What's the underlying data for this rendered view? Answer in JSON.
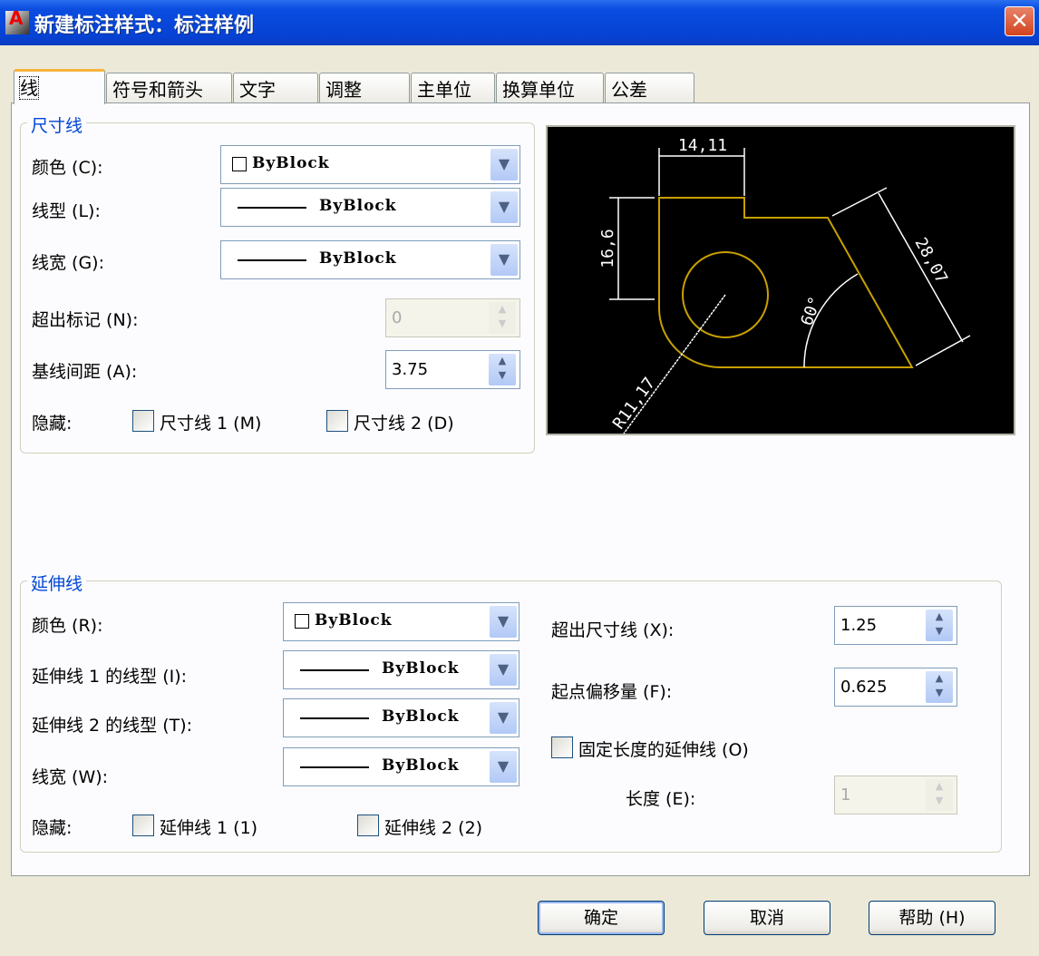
{
  "window": {
    "title": "新建标注样式：标注样例",
    "close": "✕",
    "app_icon": "A"
  },
  "tabs": [
    "线",
    "符号和箭头",
    "文字",
    "调整",
    "主单位",
    "换算单位",
    "公差"
  ],
  "dim_lines": {
    "legend": "尺寸线",
    "color_label": "颜色 (C):",
    "color_value": "ByBlock",
    "linetype_label": "线型 (L):",
    "linetype_value": "ByBlock",
    "lineweight_label": "线宽 (G):",
    "lineweight_value": "ByBlock",
    "extend_ticks_label": "超出标记 (N):",
    "extend_ticks_value": "0",
    "baseline_label": "基线间距 (A):",
    "baseline_value": "3.75",
    "suppress_label": "隐藏:",
    "suppress1": "尺寸线 1 (M)",
    "suppress2": "尺寸线 2 (D)"
  },
  "preview": {
    "dim_top": "14,11",
    "dim_left": "16,6",
    "dim_slant": "28,07",
    "dim_angle": "60°",
    "dim_radius": "R11,17"
  },
  "ext_lines": {
    "legend": "延伸线",
    "color_label": "颜色 (R):",
    "color_value": "ByBlock",
    "lt1_label": "延伸线 1 的线型 (I):",
    "lt1_value": "ByBlock",
    "lt2_label": "延伸线 2 的线型 (T):",
    "lt2_value": "ByBlock",
    "lineweight_label": "线宽 (W):",
    "lineweight_value": "ByBlock",
    "suppress_label": "隐藏:",
    "suppress1": "延伸线 1 (1)",
    "suppress2": "延伸线 2 (2)",
    "beyond_label": "超出尺寸线 (X):",
    "beyond_value": "1.25",
    "offset_label": "起点偏移量 (F):",
    "offset_value": "0.625",
    "fixed_label": "固定长度的延伸线 (O)",
    "length_label": "长度 (E):",
    "length_value": "1"
  },
  "buttons": {
    "ok": "确定",
    "cancel": "取消",
    "help": "帮助 (H)"
  },
  "colors": {
    "title_blue": "#0642d4",
    "legend_blue": "#0046d5",
    "geometry": "#c8a000"
  }
}
